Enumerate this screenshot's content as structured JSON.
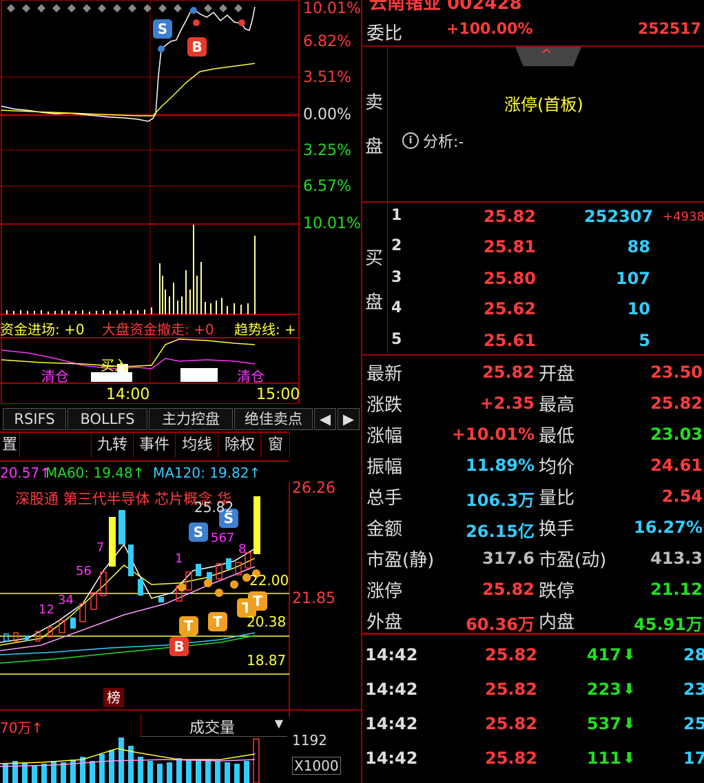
{
  "header": {
    "stock_title": "云南锗业 002428"
  },
  "intraday": {
    "pct_labels": [
      "10.01%",
      "6.82%",
      "3.51%",
      "0.00%",
      "3.25%",
      "6.57%",
      "10.01%"
    ],
    "time_labels": [
      "14:00",
      "15:00"
    ],
    "indicator_line": [
      "资金进场: +0",
      "大盘资金撤走: +0",
      "趋势线: +"
    ],
    "signal_texts": [
      "清仓",
      "买入",
      "清仓"
    ]
  },
  "tabs": [
    "RSIFS",
    "BOLLFS",
    "主力控盘",
    "绝佳卖点"
  ],
  "kline_toolbar": [
    "置",
    "九转",
    "事件",
    "均线",
    "除权",
    "窗"
  ],
  "ma_line": {
    "ma_a": "20.57↑",
    "ma60": "MA60: 19.48↑",
    "ma120": "MA120: 19.82↑"
  },
  "concepts": "深股通  第三代半导体  芯片概念  华",
  "kline_prices": [
    "26.26",
    "21.85",
    "22.00",
    "20.38",
    "18.87"
  ],
  "kline_high_label": "25.82",
  "rank_badge": "榜",
  "volume": {
    "left_label": "70万↑",
    "dropdown": "成交量",
    "right_labels": [
      "1192",
      "X1000"
    ]
  },
  "commission": {
    "label": "委比",
    "ratio": "+100.00%",
    "diff": "252517"
  },
  "sell_side": {
    "label_chars": [
      "卖",
      "盘"
    ],
    "status": "涨停(首板)",
    "analysis": "分析:-"
  },
  "buy_side": {
    "label_chars": [
      "买",
      "盘"
    ],
    "levels": [
      {
        "n": "1",
        "price": "25.82",
        "vol": "252307",
        "chg": "+4938"
      },
      {
        "n": "2",
        "price": "25.81",
        "vol": "88",
        "chg": ""
      },
      {
        "n": "3",
        "price": "25.80",
        "vol": "107",
        "chg": ""
      },
      {
        "n": "4",
        "price": "25.62",
        "vol": "10",
        "chg": ""
      },
      {
        "n": "5",
        "price": "25.61",
        "vol": "5",
        "chg": ""
      }
    ]
  },
  "stats": [
    {
      "k1": "最新",
      "v1": "25.82",
      "c1": "red",
      "k2": "开盘",
      "v2": "23.50",
      "c2": "red"
    },
    {
      "k1": "涨跌",
      "v1": "+2.35",
      "c1": "red",
      "k2": "最高",
      "v2": "25.82",
      "c2": "red"
    },
    {
      "k1": "涨幅",
      "v1": "+10.01%",
      "c1": "red",
      "k2": "最低",
      "v2": "23.03",
      "c2": "green"
    },
    {
      "k1": "振幅",
      "v1": "11.89%",
      "c1": "cyan",
      "k2": "均价",
      "v2": "24.61",
      "c2": "red"
    },
    {
      "k1": "总手",
      "v1": "106.3万",
      "c1": "cyan",
      "k2": "量比",
      "v2": "2.54",
      "c2": "red"
    },
    {
      "k1": "金额",
      "v1": "26.15亿",
      "c1": "cyan",
      "k2": "换手",
      "v2": "16.27%",
      "c2": "cyan"
    },
    {
      "k1": "市盈(静)",
      "v1": "317.6",
      "c1": "gray",
      "k2": "市盈(动)",
      "v2": "413.3",
      "c2": "gray"
    },
    {
      "k1": "涨停",
      "v1": "25.82",
      "c1": "red",
      "k2": "跌停",
      "v2": "21.12",
      "c2": "green"
    },
    {
      "k1": "外盘",
      "v1": "60.36万",
      "c1": "red",
      "k2": "内盘",
      "v2": "45.91万",
      "c2": "green"
    }
  ],
  "ticks": [
    {
      "time": "14:42",
      "price": "25.82",
      "vol": "417",
      "n": "28"
    },
    {
      "time": "14:42",
      "price": "25.82",
      "vol": "223",
      "n": "23"
    },
    {
      "time": "14:42",
      "price": "25.82",
      "vol": "537",
      "n": "25"
    },
    {
      "time": "14:42",
      "price": "25.82",
      "vol": "111",
      "n": "17"
    }
  ],
  "colors": {
    "up": "#ff3b3b",
    "down": "#22dd22",
    "grid": "#a00000"
  }
}
